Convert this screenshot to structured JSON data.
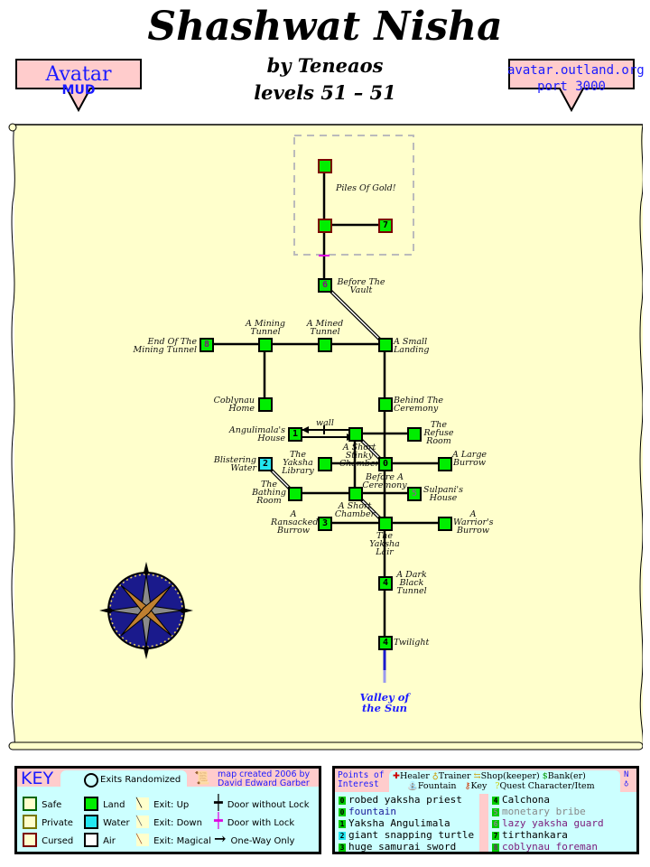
{
  "header": {
    "title": "Shashwat Nisha",
    "byline": "by Teneaos",
    "levels": "levels 51 – 51",
    "left_badge": {
      "line1": "Avatar",
      "line2": "MUD"
    },
    "right_badge": {
      "line1": "avatar.outland.org",
      "line2": "port 3000"
    }
  },
  "map": {
    "zone_note": "Piles Of Gold!",
    "wall_label": "wall",
    "exit_label": "Valley of the Sun",
    "rooms": [
      {
        "id": "vault-top",
        "label": "",
        "num": "",
        "type": "cursed"
      },
      {
        "id": "vault-mid",
        "label": "",
        "num": "",
        "type": "cursed"
      },
      {
        "id": "vault-east",
        "label": "",
        "num": "7",
        "type": "cursed"
      },
      {
        "id": "before-vault",
        "label": "Before The Vault",
        "num": "6",
        "type": "land"
      },
      {
        "id": "end-mining",
        "label": "End Of The Mining Tunnel",
        "num": "8",
        "type": "land"
      },
      {
        "id": "mining-tunnel",
        "label": "A Mining Tunnel",
        "num": "",
        "type": "land"
      },
      {
        "id": "mined-tunnel",
        "label": "A Mined Tunnel",
        "num": "",
        "type": "land"
      },
      {
        "id": "small-landing",
        "label": "A Small Landing",
        "num": "",
        "type": "land"
      },
      {
        "id": "coblynau-home",
        "label": "Coblynau Home",
        "num": "",
        "type": "land"
      },
      {
        "id": "behind-ceremony",
        "label": "Behind The Ceremony",
        "num": "",
        "type": "land"
      },
      {
        "id": "angulimala-house",
        "label": "Angulimala's House",
        "num": "1",
        "type": "land"
      },
      {
        "id": "short-stinky",
        "label": "A Short Stinky Chamber",
        "num": "",
        "type": "land"
      },
      {
        "id": "refuse-room",
        "label": "The Refuse Room",
        "num": "",
        "type": "land"
      },
      {
        "id": "blistering-water",
        "label": "Blistering Water",
        "num": "2",
        "type": "water"
      },
      {
        "id": "yaksha-library",
        "label": "The Yaksha Library",
        "num": "",
        "type": "land"
      },
      {
        "id": "before-ceremony",
        "label": "Before A Ceremony",
        "num": "0",
        "type": "land"
      },
      {
        "id": "large-burrow",
        "label": "A Large Burrow",
        "num": "",
        "type": "land"
      },
      {
        "id": "bathing-room",
        "label": "The Bathing Room",
        "num": "",
        "type": "land"
      },
      {
        "id": "short-chamber",
        "label": "A Short Chamber",
        "num": "",
        "type": "land"
      },
      {
        "id": "sulpani-house",
        "label": "Sulpani's House",
        "num": "5",
        "type": "land"
      },
      {
        "id": "ransacked-burrow",
        "label": "A Ransacked Burrow",
        "num": "3",
        "type": "land"
      },
      {
        "id": "yaksha-lair",
        "label": "The Yaksha Lair",
        "num": "",
        "type": "land"
      },
      {
        "id": "warrior-burrow",
        "label": "A Warrior's Burrow",
        "num": "",
        "type": "land"
      },
      {
        "id": "dark-tunnel",
        "label": "A Dark Black Tunnel",
        "num": "4",
        "type": "land"
      },
      {
        "id": "twilight",
        "label": "Twilight",
        "num": "4",
        "type": "land"
      }
    ]
  },
  "key": {
    "title": "KEY",
    "exits_randomized": "Exits Randomized",
    "credit_line1": "map created 2006 by",
    "credit_line2": "David Edward Garber",
    "zones": [
      "Safe",
      "Private",
      "Cursed"
    ],
    "terrain": [
      "Land",
      "Water",
      "Air"
    ],
    "exits": [
      "Exit: Up",
      "Exit: Down",
      "Exit: Magical"
    ],
    "doors": [
      "Door without Lock",
      "Door with Lock",
      "One-Way Only"
    ],
    "colors": {
      "safe": "#006600",
      "private": "#777700",
      "cursed": "#7a0000",
      "land": "#00ee00",
      "water": "#22e6f0",
      "air": "#ffffff"
    }
  },
  "poi": {
    "title_line1": "Points of",
    "title_line2": "Interest",
    "legend_row1": [
      "Healer",
      "Trainer",
      "Shop(keeper)",
      "Bank(er)"
    ],
    "legend_row2": [
      "Fountain",
      "Key",
      "Quest Character/Item"
    ],
    "compass_letter": "N",
    "left_items": [
      {
        "num": "0",
        "text": "robed yaksha priest",
        "color": "#000000"
      },
      {
        "num": "0",
        "text": "fountain",
        "color": "#1a1a99"
      },
      {
        "num": "1",
        "text": "Yaksha Angulimala",
        "color": "#000000"
      },
      {
        "num": "2",
        "text": "giant snapping turtle",
        "color": "#000000"
      },
      {
        "num": "3",
        "text": "huge samurai sword",
        "color": "#000000"
      }
    ],
    "right_items": [
      {
        "num": "4",
        "text": "Calchona",
        "color": "#000000"
      },
      {
        "num": "5",
        "text": "monetary bribe",
        "color": "#888888"
      },
      {
        "num": "6",
        "text": "lazy yaksha guard",
        "color": "#7a1a7a"
      },
      {
        "num": "7",
        "text": "tirthankara",
        "color": "#000000"
      },
      {
        "num": "8",
        "text": "coblynau foreman",
        "color": "#7a1a7a"
      }
    ]
  }
}
